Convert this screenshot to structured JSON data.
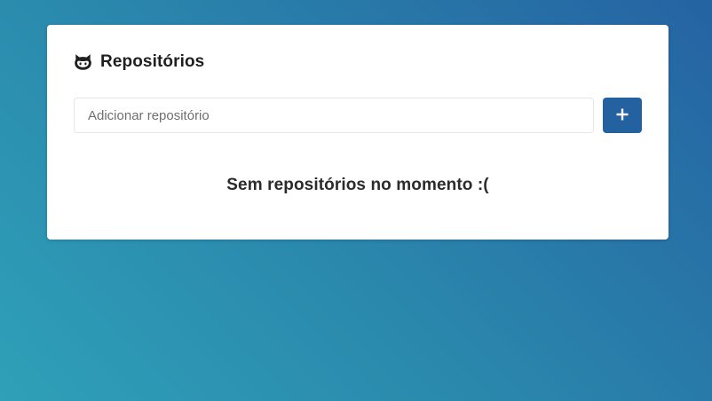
{
  "header": {
    "icon": "github-icon",
    "title": "Repositórios"
  },
  "form": {
    "input_placeholder": "Adicionar repositório",
    "input_value": "",
    "add_button_icon": "plus-icon"
  },
  "repositories": [],
  "empty_message": "Sem repositórios no momento :(",
  "colors": {
    "background_gradient_start": "#2fa0b8",
    "background_gradient_end": "#2563a3",
    "card_background": "#ffffff",
    "button_background": "#2461a1",
    "button_icon": "#ffffff"
  }
}
